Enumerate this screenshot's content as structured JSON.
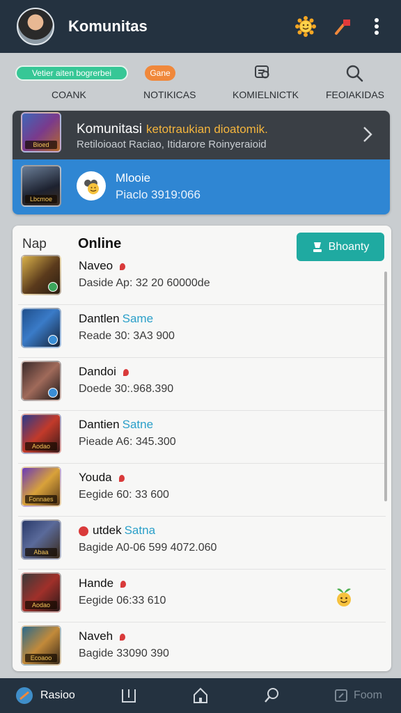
{
  "header": {
    "title": "Komunitas",
    "icons": [
      "avatar",
      "sun-emoji-icon",
      "flag-icon",
      "more-vert-icon"
    ]
  },
  "filters": {
    "chip_green": "Vetier aiten bogrerbei",
    "chip_orange": "Gane",
    "tabs": [
      "COANK",
      "NOTIKICAS",
      "KOMIELNICTK",
      "FEOIAKIDAS"
    ]
  },
  "banner": {
    "title": "Komunitasi",
    "title_accent": "ketotraukian dioatomik.",
    "subtitle": "Retiloioaot Raciao, Itidarore Roinyeraioid",
    "thumb_tag_top": "Bioed",
    "thumb_tag_bottom": "Lbcmoe",
    "member_name": "Mlooie",
    "member_sub": "Piaclo  3919:066"
  },
  "panel": {
    "left_label": "Nap",
    "title": "Online",
    "button_label": "Bhoanty"
  },
  "rows": [
    {
      "name": "Naveo",
      "highlight": "",
      "status": "after",
      "meta": "Daside  Ap: 32 20   60000de",
      "tag": "",
      "check": "green"
    },
    {
      "name": "Dantlen",
      "highlight": "Same",
      "status": "none",
      "meta": "Reade   30: 3A3 900",
      "tag": "",
      "check": "blue"
    },
    {
      "name": "Dandoi",
      "highlight": "",
      "status": "after",
      "meta": "Doede   30:.968.390",
      "tag": "",
      "check": "blue"
    },
    {
      "name": "Dantien",
      "highlight": "Satne",
      "status": "none",
      "meta": "Pieade  A6: 345.300",
      "tag": "Aodao",
      "check": ""
    },
    {
      "name": "Youda",
      "highlight": "",
      "status": "after",
      "meta": "Eegide   60: 33 600",
      "tag": "Fonnaes",
      "check": ""
    },
    {
      "name": "utdek",
      "highlight": "Satna",
      "status": "before",
      "meta": "Bagide   A0-06 599  4072.060",
      "tag": "Abaa",
      "check": ""
    },
    {
      "name": "Hande",
      "highlight": "",
      "status": "after",
      "meta": "Eegide   06:33 610",
      "tag": "Aodao",
      "check": ""
    },
    {
      "name": "Naveh",
      "highlight": "",
      "status": "after",
      "meta": "Bagide   33090 390",
      "tag": "Ecoaoo",
      "check": ""
    }
  ],
  "bottom_nav": {
    "left_label": "Rasioo",
    "right_label": "Foom"
  },
  "colors": {
    "topbar": "#243240",
    "banner_blue": "#2f86d3",
    "accent_teal": "#1faaa1",
    "chip_green": "#37c796",
    "chip_orange": "#f0883b"
  }
}
